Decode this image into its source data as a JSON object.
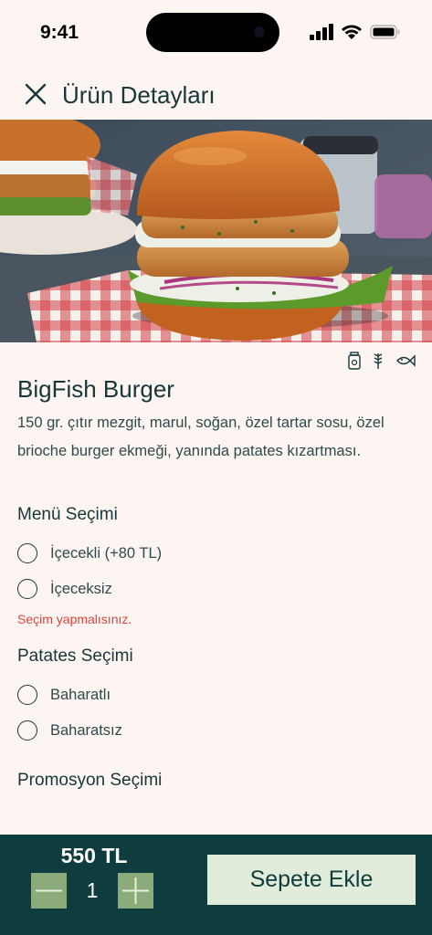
{
  "status_bar": {
    "time": "9:41"
  },
  "header": {
    "title": "Ürün Detayları"
  },
  "product": {
    "name": "BigFish Burger",
    "description": "150 gr. çıtır mezgit, marul, soğan, özel tartar sosu, özel brioche burger ekmeği, yanında patates kızartması."
  },
  "diet_icons": [
    "allergen-jar-icon",
    "wheat-icon",
    "fish-icon"
  ],
  "menu_section": {
    "title": "Menü Seçimi",
    "options": [
      "İçecekli (+80 TL)",
      "İçeceksiz"
    ],
    "error": "Seçim yapmalısınız."
  },
  "fries_section": {
    "title": "Patates Seçimi",
    "options": [
      "Baharatlı",
      "Baharatsız"
    ]
  },
  "promo_section": {
    "title": "Promosyon Seçimi"
  },
  "footer": {
    "price": "550 TL",
    "quantity": "1",
    "add_to_cart_label": "Sepete Ekle"
  },
  "colors": {
    "background": "#fdf5f2",
    "primary": "#0f3c3c",
    "accent": "#8cab7a",
    "error": "#e2423b"
  }
}
